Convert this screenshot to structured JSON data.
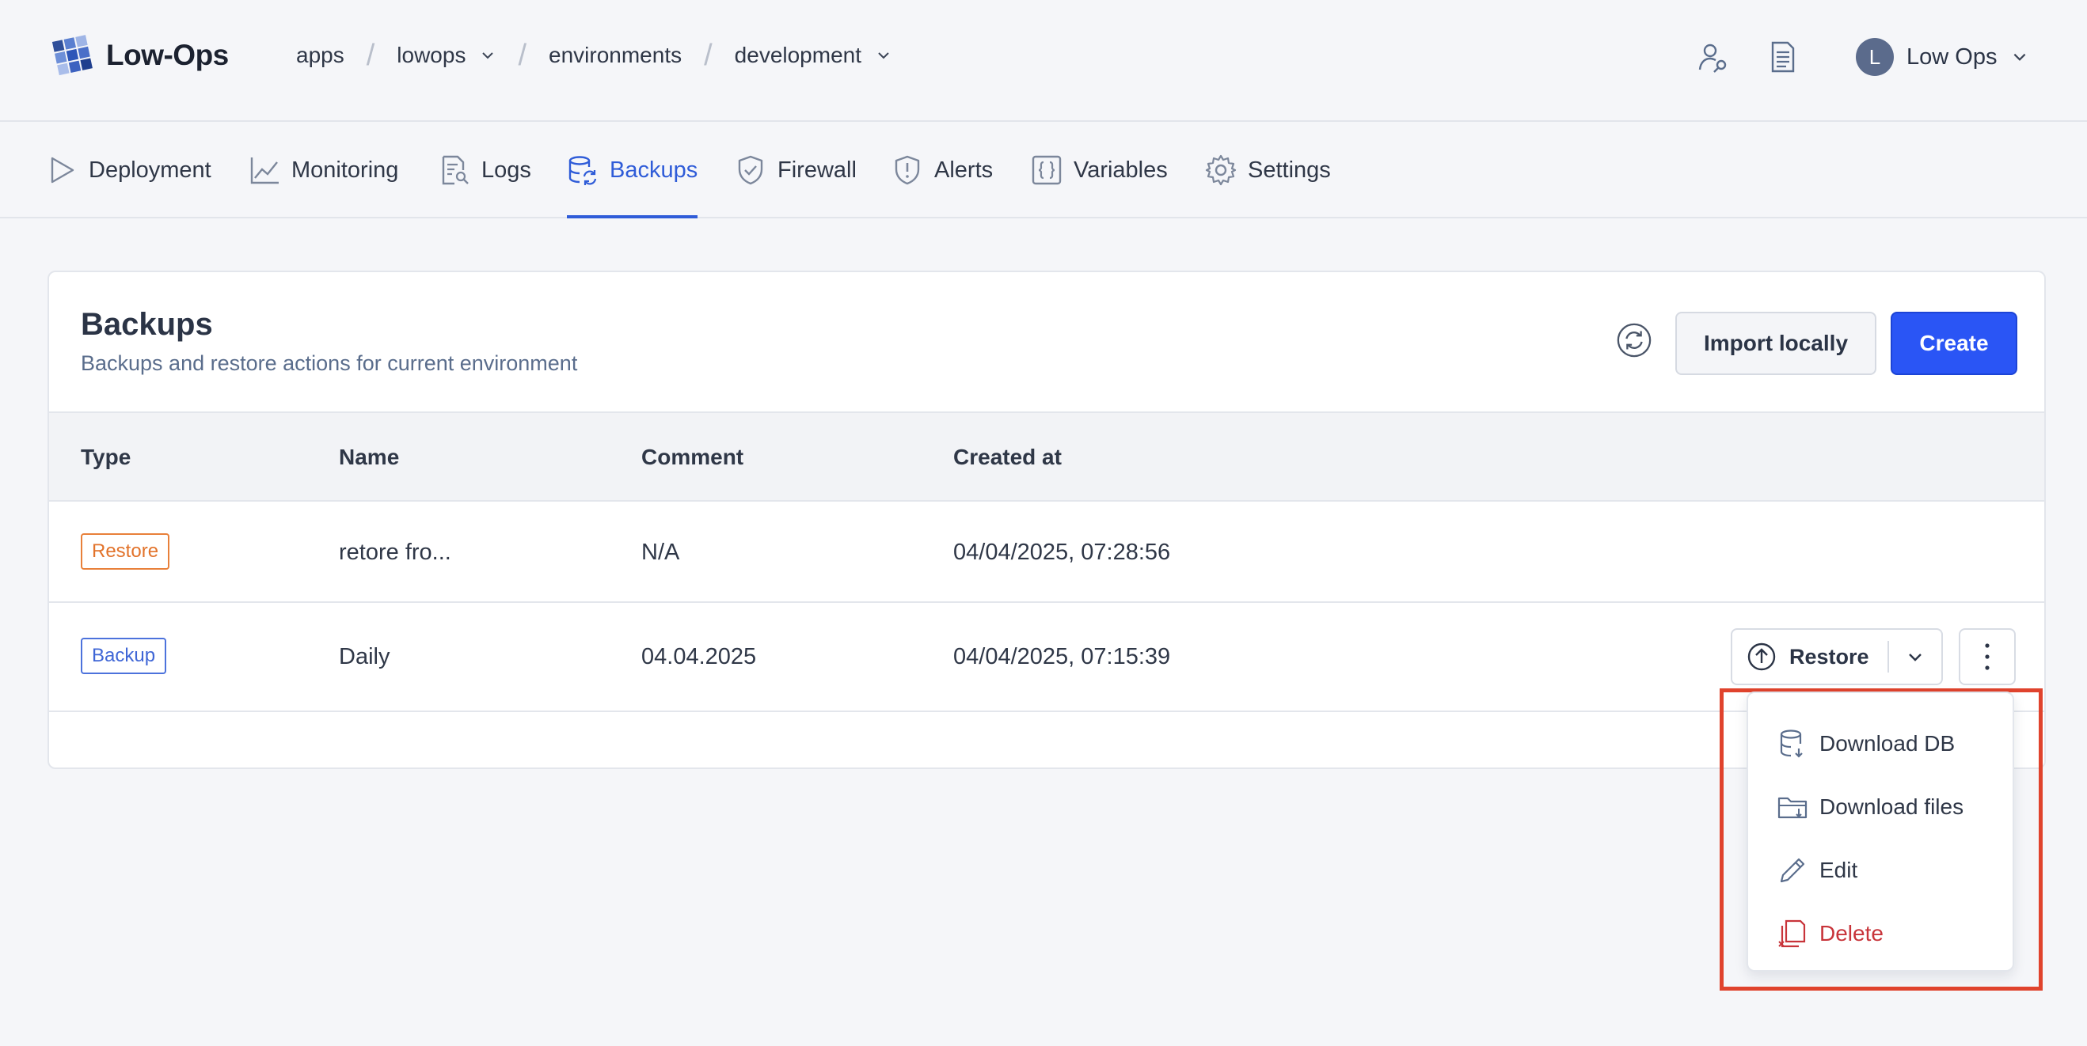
{
  "app": {
    "name": "Low-Ops"
  },
  "breadcrumb": [
    {
      "label": "apps",
      "dropdown": false
    },
    {
      "label": "lowops",
      "dropdown": true
    },
    {
      "label": "environments",
      "dropdown": false
    },
    {
      "label": "development",
      "dropdown": true
    }
  ],
  "header": {
    "icons": [
      "user-key-icon",
      "document-icon"
    ],
    "user": {
      "initial": "L",
      "name": "Low Ops"
    }
  },
  "tabs": [
    {
      "label": "Deployment",
      "icon": "play-icon",
      "active": false
    },
    {
      "label": "Monitoring",
      "icon": "chart-line-icon",
      "active": false
    },
    {
      "label": "Logs",
      "icon": "log-file-icon",
      "active": false
    },
    {
      "label": "Backups",
      "icon": "database-sync-icon",
      "active": true
    },
    {
      "label": "Firewall",
      "icon": "shield-check-icon",
      "active": false
    },
    {
      "label": "Alerts",
      "icon": "shield-alert-icon",
      "active": false
    },
    {
      "label": "Variables",
      "icon": "braces-icon",
      "active": false
    },
    {
      "label": "Settings",
      "icon": "gear-icon",
      "active": false
    }
  ],
  "card": {
    "title": "Backups",
    "subtitle": "Backups and restore actions for current environment",
    "import_label": "Import locally",
    "create_label": "Create"
  },
  "table": {
    "columns": [
      "Type",
      "Name",
      "Comment",
      "Created at"
    ],
    "rows": [
      {
        "type": "Restore",
        "name": "retore fro...",
        "comment": "N/A",
        "created_at": "04/04/2025, 07:28:56"
      },
      {
        "type": "Backup",
        "name": "Daily",
        "comment": "04.04.2025",
        "created_at": "04/04/2025, 07:15:39"
      }
    ]
  },
  "row_actions": {
    "restore_label": "Restore"
  },
  "menu": {
    "items": [
      {
        "label": "Download DB",
        "icon": "database-download-icon"
      },
      {
        "label": "Download files",
        "icon": "folder-download-icon"
      },
      {
        "label": "Edit",
        "icon": "pencil-icon"
      },
      {
        "label": "Delete",
        "icon": "trash-icon",
        "danger": true
      }
    ]
  },
  "colors": {
    "accent": "#2f5cd8",
    "primary_button": "#2a55f5",
    "restore_badge": "#e2732b",
    "backup_badge": "#3f66d6",
    "danger": "#c8343a",
    "highlight": "#e0432d"
  }
}
